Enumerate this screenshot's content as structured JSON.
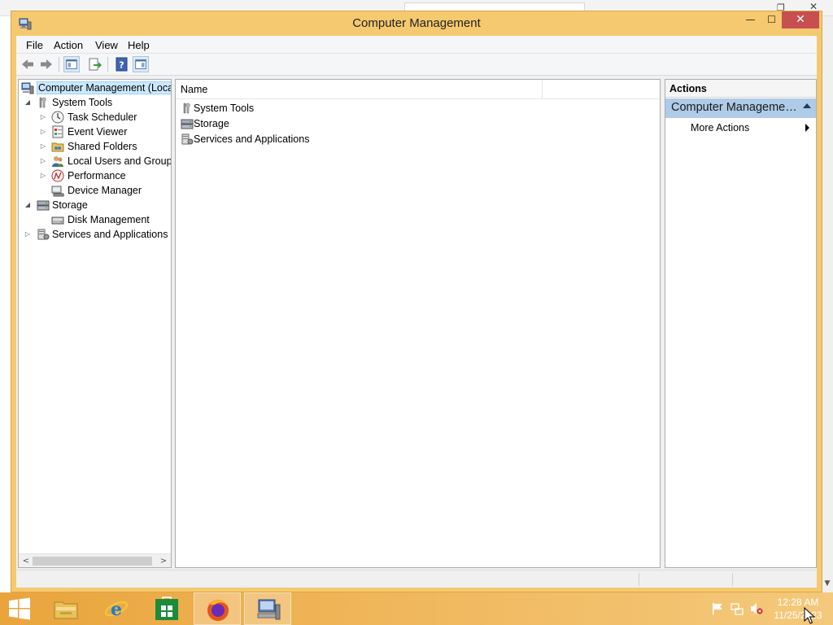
{
  "window": {
    "title": "Computer Management",
    "min_glyph": "—",
    "max_glyph": "☐",
    "close_glyph": "✕"
  },
  "menubar": {
    "items": [
      "File",
      "Action",
      "View",
      "Help"
    ]
  },
  "toolbar": {
    "buttons": [
      "back",
      "forward",
      "show-hide-console-tree",
      "export-list",
      "help",
      "show-hide-action-pane"
    ]
  },
  "tree": {
    "items": [
      {
        "label": "Computer Management (Local",
        "icon": "computer-management-icon",
        "level": 0,
        "expander": "none",
        "selected": true
      },
      {
        "label": "System Tools",
        "icon": "system-tools-icon",
        "level": 1,
        "expander": "expanded"
      },
      {
        "label": "Task Scheduler",
        "icon": "clock-icon",
        "level": 2,
        "expander": "collapsed"
      },
      {
        "label": "Event Viewer",
        "icon": "event-viewer-icon",
        "level": 2,
        "expander": "collapsed"
      },
      {
        "label": "Shared Folders",
        "icon": "shared-folder-icon",
        "level": 2,
        "expander": "collapsed"
      },
      {
        "label": "Local Users and Groups",
        "icon": "users-icon",
        "level": 2,
        "expander": "collapsed"
      },
      {
        "label": "Performance",
        "icon": "performance-icon",
        "level": 2,
        "expander": "collapsed"
      },
      {
        "label": "Device Manager",
        "icon": "device-manager-icon",
        "level": 2,
        "expander": "none"
      },
      {
        "label": "Storage",
        "icon": "storage-icon",
        "level": 1,
        "expander": "expanded"
      },
      {
        "label": "Disk Management",
        "icon": "disk-icon",
        "level": 2,
        "expander": "none"
      },
      {
        "label": "Services and Applications",
        "icon": "services-icon",
        "level": 1,
        "expander": "collapsed"
      }
    ]
  },
  "list": {
    "column_name": "Name",
    "rows": [
      {
        "label": "System Tools",
        "icon": "system-tools-icon"
      },
      {
        "label": "Storage",
        "icon": "storage-icon"
      },
      {
        "label": "Services and Applications",
        "icon": "services-icon"
      }
    ]
  },
  "actions": {
    "title": "Actions",
    "group_label": "Computer Management (Local)",
    "more_actions": "More Actions"
  },
  "taskbar": {
    "apps": [
      "start-button",
      "file-explorer",
      "internet-explorer",
      "store",
      "firefox",
      "computer-management"
    ],
    "clock_time": "12:28 AM",
    "clock_date": "11/25/2023"
  },
  "colors": {
    "window_frame": "#f5c96f",
    "close_button": "#c74f4f",
    "selection": "#cce8ff",
    "actions_group": "#aecbe8",
    "taskbar": "#f0b65a"
  }
}
